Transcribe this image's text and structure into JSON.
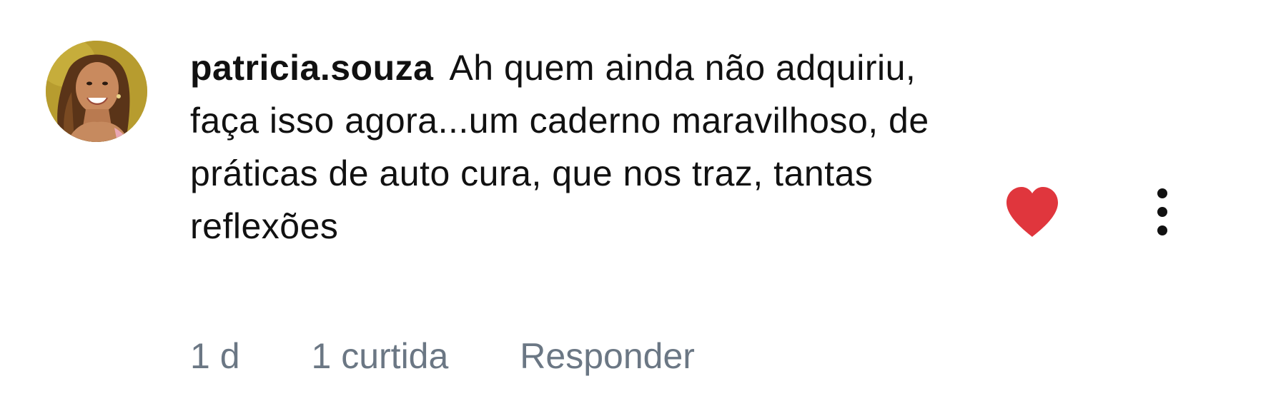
{
  "comment": {
    "username": "patricia.souza",
    "text": "Ah quem ainda não adquiriu, faça isso agora...um caderno maravilhoso, de práticas de auto cura, que nos traz, tantas reflexões",
    "timestamp": "1 d",
    "likes": "1 curtida",
    "reply_label": "Responder",
    "liked": true
  },
  "icons": {
    "avatar": "user-avatar-photo",
    "like": "heart-filled-icon",
    "more": "more-vertical-icon"
  },
  "colors": {
    "heart": "#e0363d",
    "meta_text": "#6b7784",
    "primary_text": "#111111",
    "background": "#ffffff"
  }
}
